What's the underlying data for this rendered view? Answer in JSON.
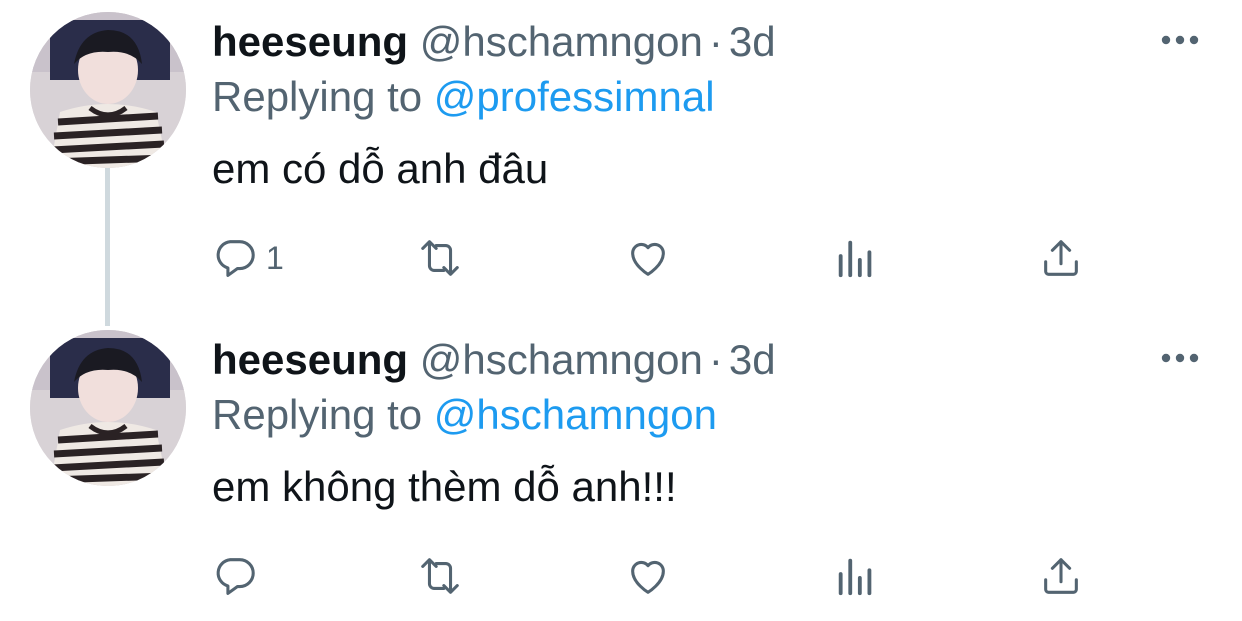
{
  "tweets": [
    {
      "name": "heeseung",
      "handle": "@hschamngon",
      "separator": "·",
      "time": "3d",
      "reply_prefix": "Replying to",
      "reply_to": "@professimnal",
      "text": "em có dỗ anh đâu",
      "reply_count": "1",
      "icons": [
        "more-icon",
        "reply-icon",
        "retweet-icon",
        "like-icon",
        "views-icon",
        "share-icon"
      ]
    },
    {
      "name": "heeseung",
      "handle": "@hschamngon",
      "separator": "·",
      "time": "3d",
      "reply_prefix": "Replying to",
      "reply_to": "@hschamngon",
      "text": "em không thèm dỗ anh!!!",
      "reply_count": "",
      "icons": [
        "more-icon",
        "reply-icon",
        "retweet-icon",
        "like-icon",
        "views-icon",
        "share-icon"
      ]
    }
  ],
  "colors": {
    "primary_text": "#0f1419",
    "secondary_text": "#536471",
    "link": "#1d9bf0",
    "thread_line": "#cfd9de"
  }
}
